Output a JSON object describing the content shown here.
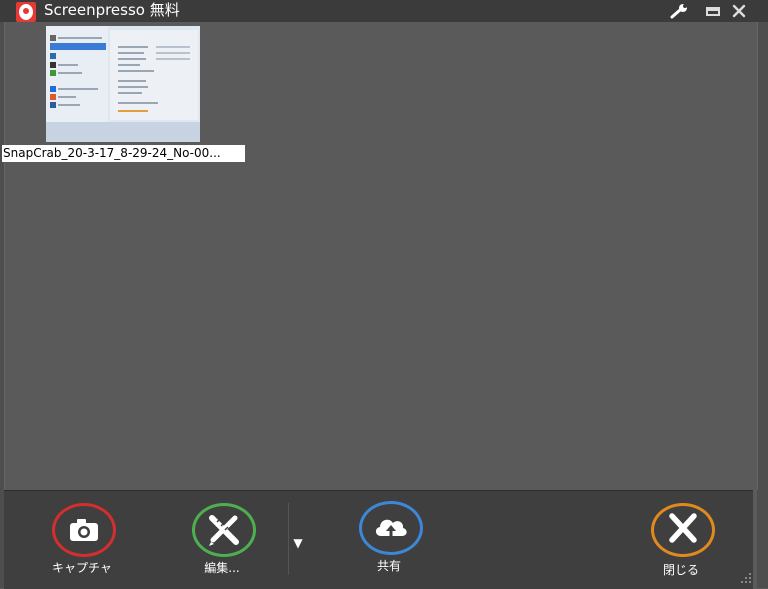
{
  "window": {
    "title": "Screenpresso 無料",
    "logo_icon": "screenpresso-logo-icon",
    "controls": [
      "wrench-icon",
      "minimize-icon",
      "close-icon"
    ]
  },
  "gallery": {
    "items": [
      {
        "caption": "SnapCrab_20-3-17_8-29-24_No-00..."
      }
    ]
  },
  "toolbar": {
    "capture": {
      "label": "キャプチャ",
      "icon": "camera-icon",
      "color": "#d32f2f"
    },
    "edit": {
      "label": "編集...",
      "icon": "edit-tools-icon",
      "color": "#4caf50"
    },
    "edit_dropdown": "▼",
    "share": {
      "label": "共有",
      "icon": "cloud-upload-icon",
      "color": "#3f87d6"
    },
    "close": {
      "label": "閉じる",
      "icon": "close-x-icon",
      "color": "#e08a1e"
    }
  }
}
